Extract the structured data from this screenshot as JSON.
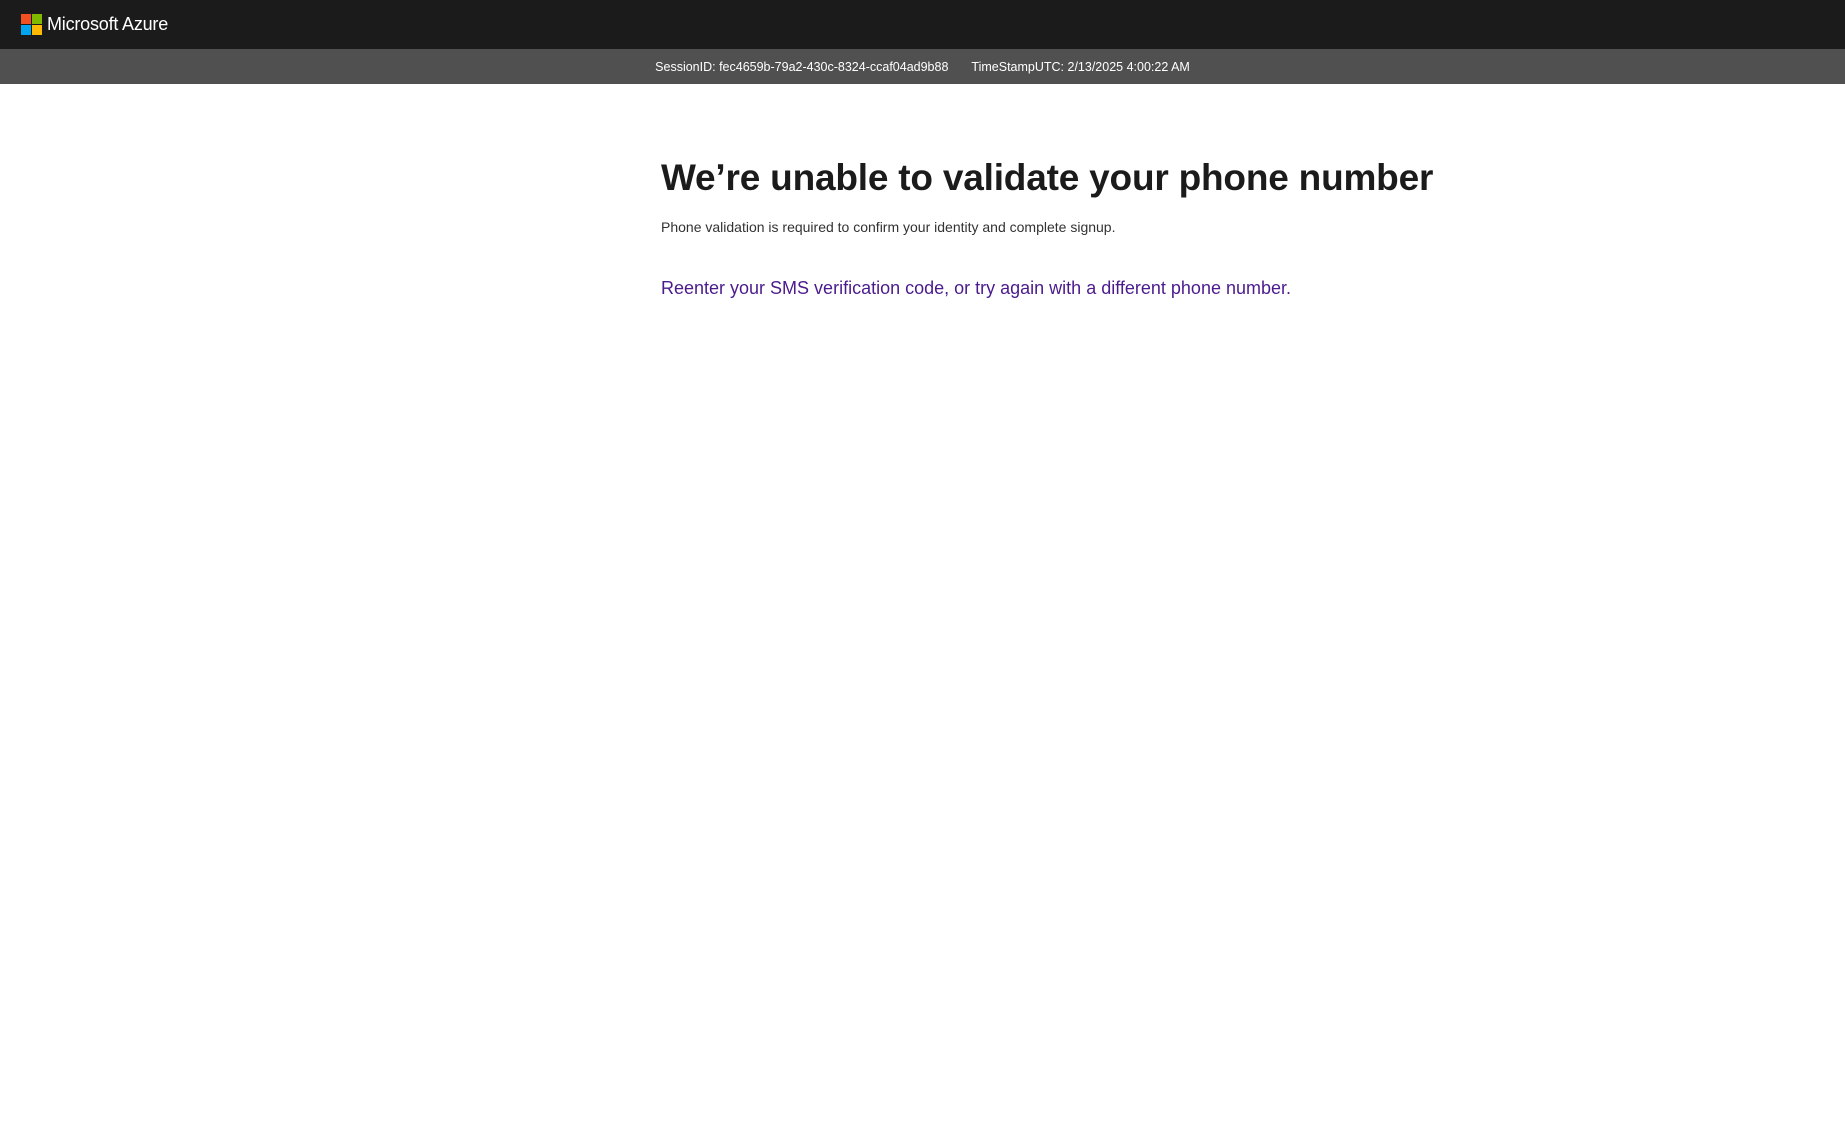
{
  "header": {
    "brand": "Microsoft Azure",
    "logo_colors": [
      "#f25022",
      "#7fba00",
      "#00a4ef",
      "#ffb900"
    ],
    "background": "#1b1b1b"
  },
  "session_bar": {
    "session_id": "SessionID: fec4659b-79a2-430c-8324-ccaf04ad9b88",
    "timestamp": "TimeStampUTC: 2/13/2025 4:00:22 AM",
    "background": "#505050"
  },
  "main": {
    "title": "We’re unable to validate your phone number",
    "subtitle": "Phone validation is required to confirm your identity and complete signup.",
    "retry_link": "Reenter your SMS verification code, or try again with a different phone number.",
    "link_color": "#4b1b8d"
  }
}
